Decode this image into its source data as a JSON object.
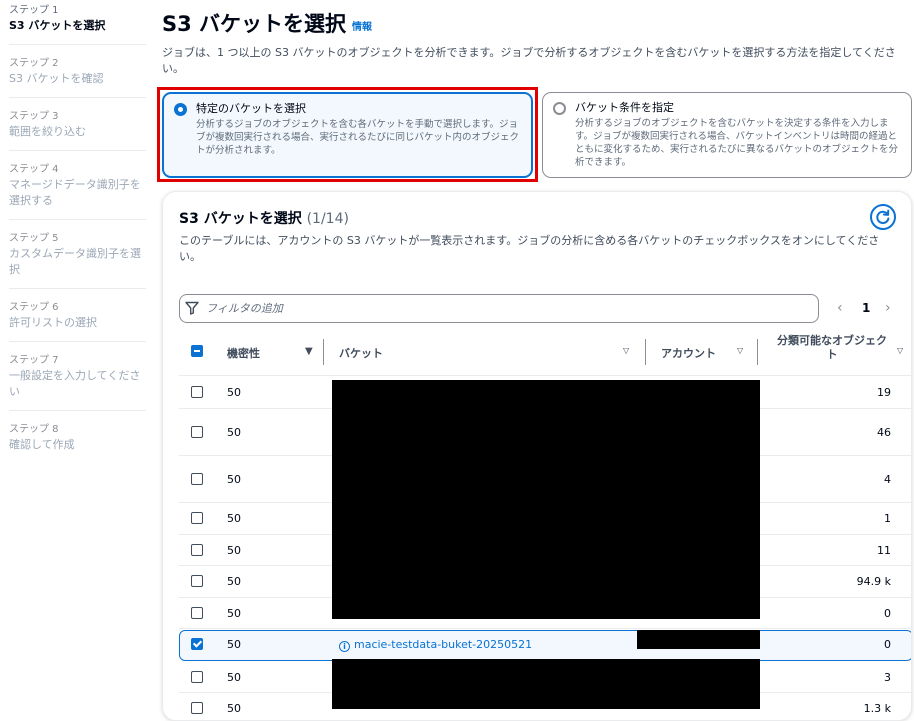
{
  "steps": [
    {
      "num": "ステップ 1",
      "title": "S3 バケットを選択"
    },
    {
      "num": "ステップ 2",
      "title": "S3 バケットを確認"
    },
    {
      "num": "ステップ 3",
      "title": "範囲を絞り込む"
    },
    {
      "num": "ステップ 4",
      "title": "マネージドデータ識別子を選択する"
    },
    {
      "num": "ステップ 5",
      "title": "カスタムデータ識別子を選択"
    },
    {
      "num": "ステップ 6",
      "title": "許可リストの選択"
    },
    {
      "num": "ステップ 7",
      "title": "一般設定を入力してください"
    },
    {
      "num": "ステップ 8",
      "title": "確認して作成"
    }
  ],
  "header": {
    "title": "S3 バケットを選択",
    "info": "情報",
    "description": "ジョブは、1 つ以上の S3 バケットのオブジェクトを分析できます。ジョブで分析するオブジェクトを含むバケットを選択する方法を指定してください。"
  },
  "tiles": {
    "specific": {
      "title": "特定のバケットを選択",
      "desc": "分析するジョブのオブジェクトを含む各バケットを手動で選択します。ジョブが複数回実行される場合、実行されるたびに同じバケット内のオブジェクトが分析されます。"
    },
    "criteria": {
      "title": "バケット条件を指定",
      "desc": "分析するジョブのオブジェクトを含むバケットを決定する条件を入力します。ジョブが複数回実行される場合、バケットインベントリは時間の経過とともに変化するため、実行されるたびに異なるバケットのオブジェクトを分析できます。"
    }
  },
  "table": {
    "title": "S3 バケットを選択",
    "count": "(1/14)",
    "description": "このテーブルには、アカウントの S3 バケットが一覧表示されます。ジョブの分析に含める各バケットのチェックボックスをオンにしてください。",
    "filter_placeholder": "フィルタの追加",
    "page": "1",
    "columns": {
      "sensitivity": "機密性",
      "bucket": "バケット",
      "account": "アカウント",
      "objects": "分類可能なオブジェクト"
    },
    "rows": [
      {
        "sensitivity": "50",
        "objects": "19",
        "checked": false
      },
      {
        "sensitivity": "50",
        "objects": "46",
        "checked": false
      },
      {
        "sensitivity": "50",
        "objects": "4",
        "checked": false
      },
      {
        "sensitivity": "50",
        "objects": "1",
        "checked": false
      },
      {
        "sensitivity": "50",
        "objects": "11",
        "checked": false
      },
      {
        "sensitivity": "50",
        "objects": "94.9 k",
        "checked": false
      },
      {
        "sensitivity": "50",
        "objects": "0",
        "checked": false
      },
      {
        "sensitivity": "50",
        "bucket": "macie-testdata-buket-20250521",
        "objects": "0",
        "checked": true
      },
      {
        "sensitivity": "50",
        "objects": "3",
        "checked": false
      },
      {
        "sensitivity": "50",
        "objects": "1.3 k",
        "checked": false
      }
    ]
  },
  "colors": {
    "accent": "#0972d3",
    "highlight": "#e00000",
    "text": "#000716"
  }
}
